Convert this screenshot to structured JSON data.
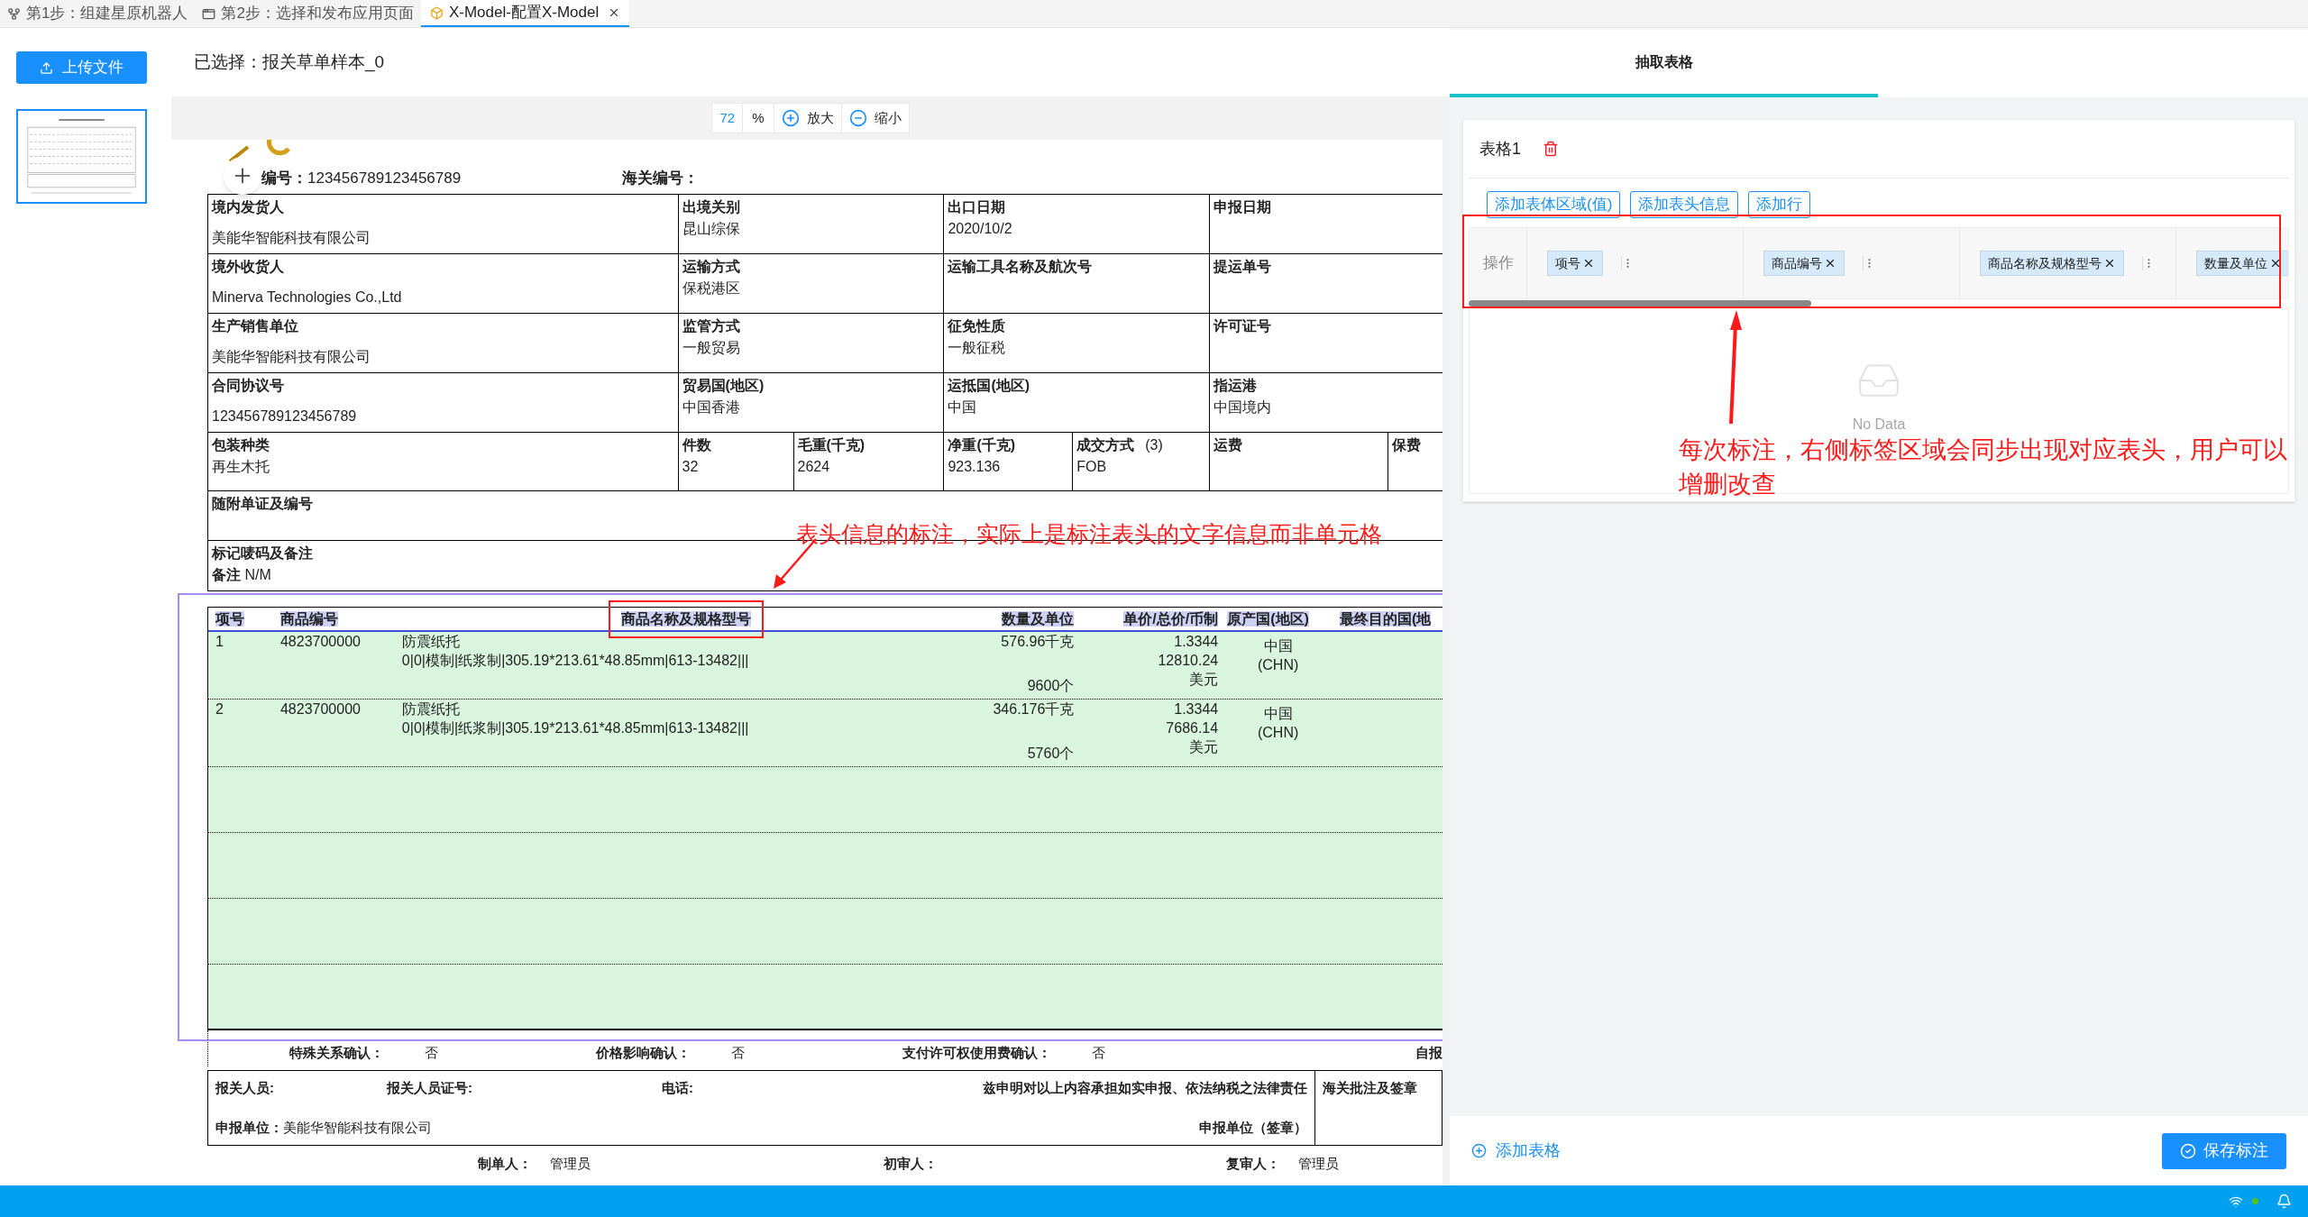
{
  "tabs": [
    {
      "label": "第1步：组建星原机器人",
      "selected": false,
      "kind": "flow"
    },
    {
      "label": "第2步：选择和发布应用页面",
      "selected": false,
      "kind": "page"
    },
    {
      "label": "X-Model-配置X-Model",
      "selected": true,
      "kind": "model"
    }
  ],
  "upload_button": "上传文件",
  "thumbnails": [
    {
      "selected": true
    }
  ],
  "selection_label": "已选择：报关草单样本_0",
  "zoom": {
    "value": "72",
    "unit": "%",
    "zoom_in": "放大",
    "zoom_out": "缩小"
  },
  "document": {
    "top_fields": [
      {
        "label": "编号：",
        "value": "123456789123456789"
      },
      {
        "label": "海关编号："
      }
    ],
    "form_rows": [
      [
        {
          "label": "境内发货人",
          "value": "美能华智能科技有限公司"
        },
        {
          "label": "出境关别",
          "value": "昆山综保"
        },
        {
          "label": "出口日期",
          "value": "2020/10/2"
        },
        {
          "label": "申报日期"
        }
      ],
      [
        {
          "label": "境外收货人",
          "value": "Minerva Technologies Co.,Ltd"
        },
        {
          "label": "运输方式",
          "value": "保税港区"
        },
        {
          "label": "运输工具名称及航次号"
        },
        {
          "label": "提运单号"
        }
      ],
      [
        {
          "label": "生产销售单位",
          "value": "美能华智能科技有限公司"
        },
        {
          "label": "监管方式",
          "value": "一般贸易"
        },
        {
          "label": "征免性质",
          "value": "一般征税"
        },
        {
          "label": "许可证号"
        }
      ],
      [
        {
          "label": "合同协议号",
          "value": "123456789123456789"
        },
        {
          "label": "贸易国(地区)",
          "value": "中国香港"
        },
        {
          "label": "运抵国(地区)",
          "value": "中国"
        },
        {
          "label": "指运港",
          "value": "中国境内"
        }
      ],
      [
        {
          "label": "包装种类",
          "value": "再生木托"
        },
        {
          "label": "件数",
          "value": "32"
        },
        {
          "label": "毛重(千克)",
          "value": "2624"
        },
        {
          "label": "净重(千克)",
          "value": "923.136"
        },
        {
          "label": "成交方式",
          "note": "(3)",
          "value": "FOB"
        },
        {
          "label": "运费"
        },
        {
          "label": "保费"
        }
      ],
      [
        {
          "label": "随附单证及编号"
        }
      ],
      [
        {
          "label": "标记唛码及备注",
          "value": "**备注**  N/M"
        }
      ]
    ],
    "goods_columns": [
      {
        "label": "项号",
        "outlined": false
      },
      {
        "label": "商品编号",
        "outlined": false
      },
      {
        "label": "商品名称及规格型号",
        "outlined": true
      },
      {
        "label": "数量及单位",
        "outlined": false
      },
      {
        "label": "单价/总价/币制",
        "outlined": false
      },
      {
        "label": "原产国(地区)",
        "outlined": false
      },
      {
        "label": "最终目的国(地",
        "outlined": false
      }
    ],
    "goods_rows": [
      {
        "no": "1",
        "code": "4823700000",
        "name": "防震纸托",
        "spec": "0|0|模制|纸浆制|305.19*213.61*48.85mm|613-13482|||",
        "quantity": [
          "576.96千克",
          "9600个"
        ],
        "price": [
          "1.3344",
          "12810.24",
          "美元"
        ],
        "origin": [
          "中国",
          "(CHN)"
        ]
      },
      {
        "no": "2",
        "code": "4823700000",
        "name": "防震纸托",
        "spec": "0|0|模制|纸浆制|305.19*213.61*48.85mm|613-13482|||",
        "quantity": [
          "346.176千克",
          "5760个"
        ],
        "price": [
          "1.3344",
          "7686.14",
          "美元"
        ],
        "origin": [
          "中国",
          "(CHN)"
        ]
      }
    ],
    "confirmations": [
      {
        "label": "特殊关系确认：",
        "value": "否"
      },
      {
        "label": "价格影响确认：",
        "value": "否"
      },
      {
        "label": "支付许可权使用费确认：",
        "value": "否"
      },
      {
        "label": "自报"
      }
    ],
    "declaration": {
      "staff": "报关人员:",
      "staff_id": "报关人员证号:",
      "phone": "电话:",
      "statement": "兹申明对以上内容承担如实申报、依法纳税之法律责任",
      "customs": "海关批注及签章",
      "unit_label": "申报单位：",
      "unit_value": "美能华智能科技有限公司",
      "seal": "申报单位（签章）"
    },
    "signatures": [
      {
        "label": "制单人：",
        "value": "管理员"
      },
      {
        "label": "初审人："
      },
      {
        "label": "复审人：",
        "value": "管理员"
      }
    ]
  },
  "panel_tabs": [
    {
      "label": "抽取表格",
      "selected": true
    }
  ],
  "table_card": {
    "title": "表格1",
    "actions": [
      "添加表体区域(值)",
      "添加表头信息",
      "添加行"
    ],
    "operation_header": "操作",
    "columns": [
      {
        "tag": "项号"
      },
      {
        "tag": "商品编号"
      },
      {
        "tag": "商品名称及规格型号"
      },
      {
        "tag": "数量及单位"
      }
    ],
    "empty_text": "No Data"
  },
  "footer": {
    "add_table": "添加表格",
    "save": "保存标注"
  },
  "annotations": [
    {
      "text": "表头信息的标注，实际上是标注表头的文字信息而非单元格"
    },
    {
      "text": "每次标注，右侧标签区域会同步出现对应表头，用户可以增删改查"
    }
  ]
}
